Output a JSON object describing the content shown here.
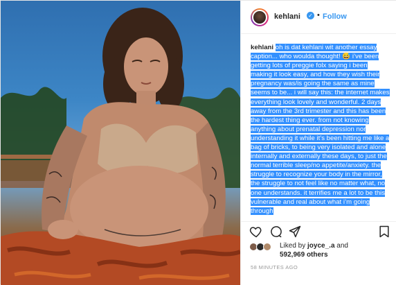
{
  "post": {
    "username": "kehlani",
    "follow_label": "Follow",
    "dot": "•",
    "verified_glyph": "✓"
  },
  "caption": {
    "user": "kehlani",
    "text": "oh is dat kehlani wit another essay caption... who woulda thought! 😅 i’ve been getting lots of preggie folx saying i been making it look easy, and how they wish their pregnancy was/is going the same as mine seems to be... i will say this: the internet makes everything look lovely and wonderful. 2 days away from the 3rd trimester and this has been the hardest thing ever. from not knowing anything about prenatal depression nor understanding it while it’s been hitting me like a bag of bricks, to being very isolated and alone internally and externally these days, to just the normal terrible sleep/no appetite/anxiety. the struggle to recognize your body in the mirror, the struggle to not feel like no matter what, no one understands. it terrifies me a lot to be this vulnerable and real about what i’m going through"
  },
  "likes": {
    "prefix": "Liked by",
    "first_user": "joyce_.a",
    "conjunction": "and",
    "count": "592,969",
    "suffix": "others"
  },
  "timestamp": "58 MINUTES AGO",
  "colors": {
    "link_blue": "#3897f0",
    "selection": "#3390ff",
    "text": "#262626",
    "muted": "#999999"
  },
  "icons": [
    "heart-icon",
    "comment-icon",
    "share-icon",
    "bookmark-icon",
    "verified-badge-icon"
  ]
}
